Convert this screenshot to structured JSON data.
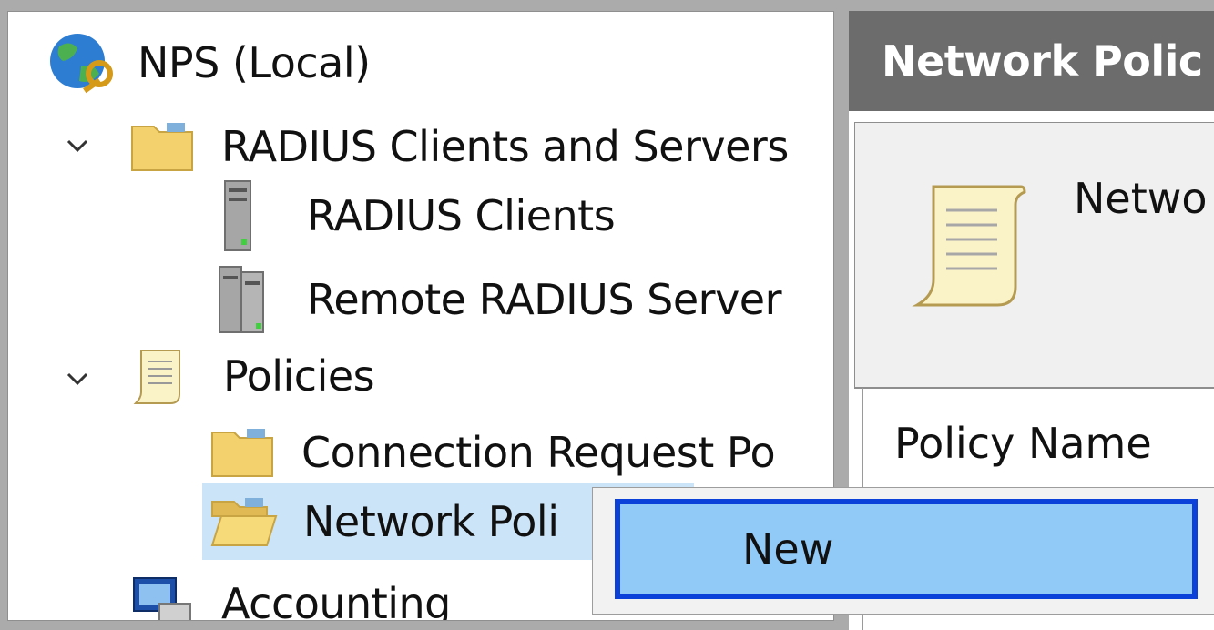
{
  "tree": {
    "root": {
      "label": "NPS (Local)",
      "icon": "globe-key-icon"
    },
    "items": [
      {
        "label": "RADIUS Clients and Servers",
        "icon": "folder-icon",
        "expanded": true
      },
      {
        "label": "RADIUS Clients",
        "icon": "server-icon"
      },
      {
        "label": "Remote RADIUS Server",
        "icon": "server-group-icon"
      },
      {
        "label": "Policies",
        "icon": "scroll-icon",
        "expanded": true
      },
      {
        "label": "Connection Request Po",
        "icon": "folder-icon"
      },
      {
        "label": "Network Poli",
        "icon": "open-folder-icon",
        "selected": true
      },
      {
        "label": "Accounting",
        "icon": "accounting-icon"
      }
    ]
  },
  "right": {
    "header_title": "Network Polic",
    "info_text": "Netwo",
    "column_header": "Policy Name"
  },
  "context_menu": {
    "items": [
      {
        "label": "New",
        "highlighted": true
      }
    ]
  },
  "colors": {
    "selection": "#cce4f7",
    "menu_highlight": "#91c9f7",
    "menu_border": "#0b41d8",
    "header_bg": "#6c6c6c"
  }
}
